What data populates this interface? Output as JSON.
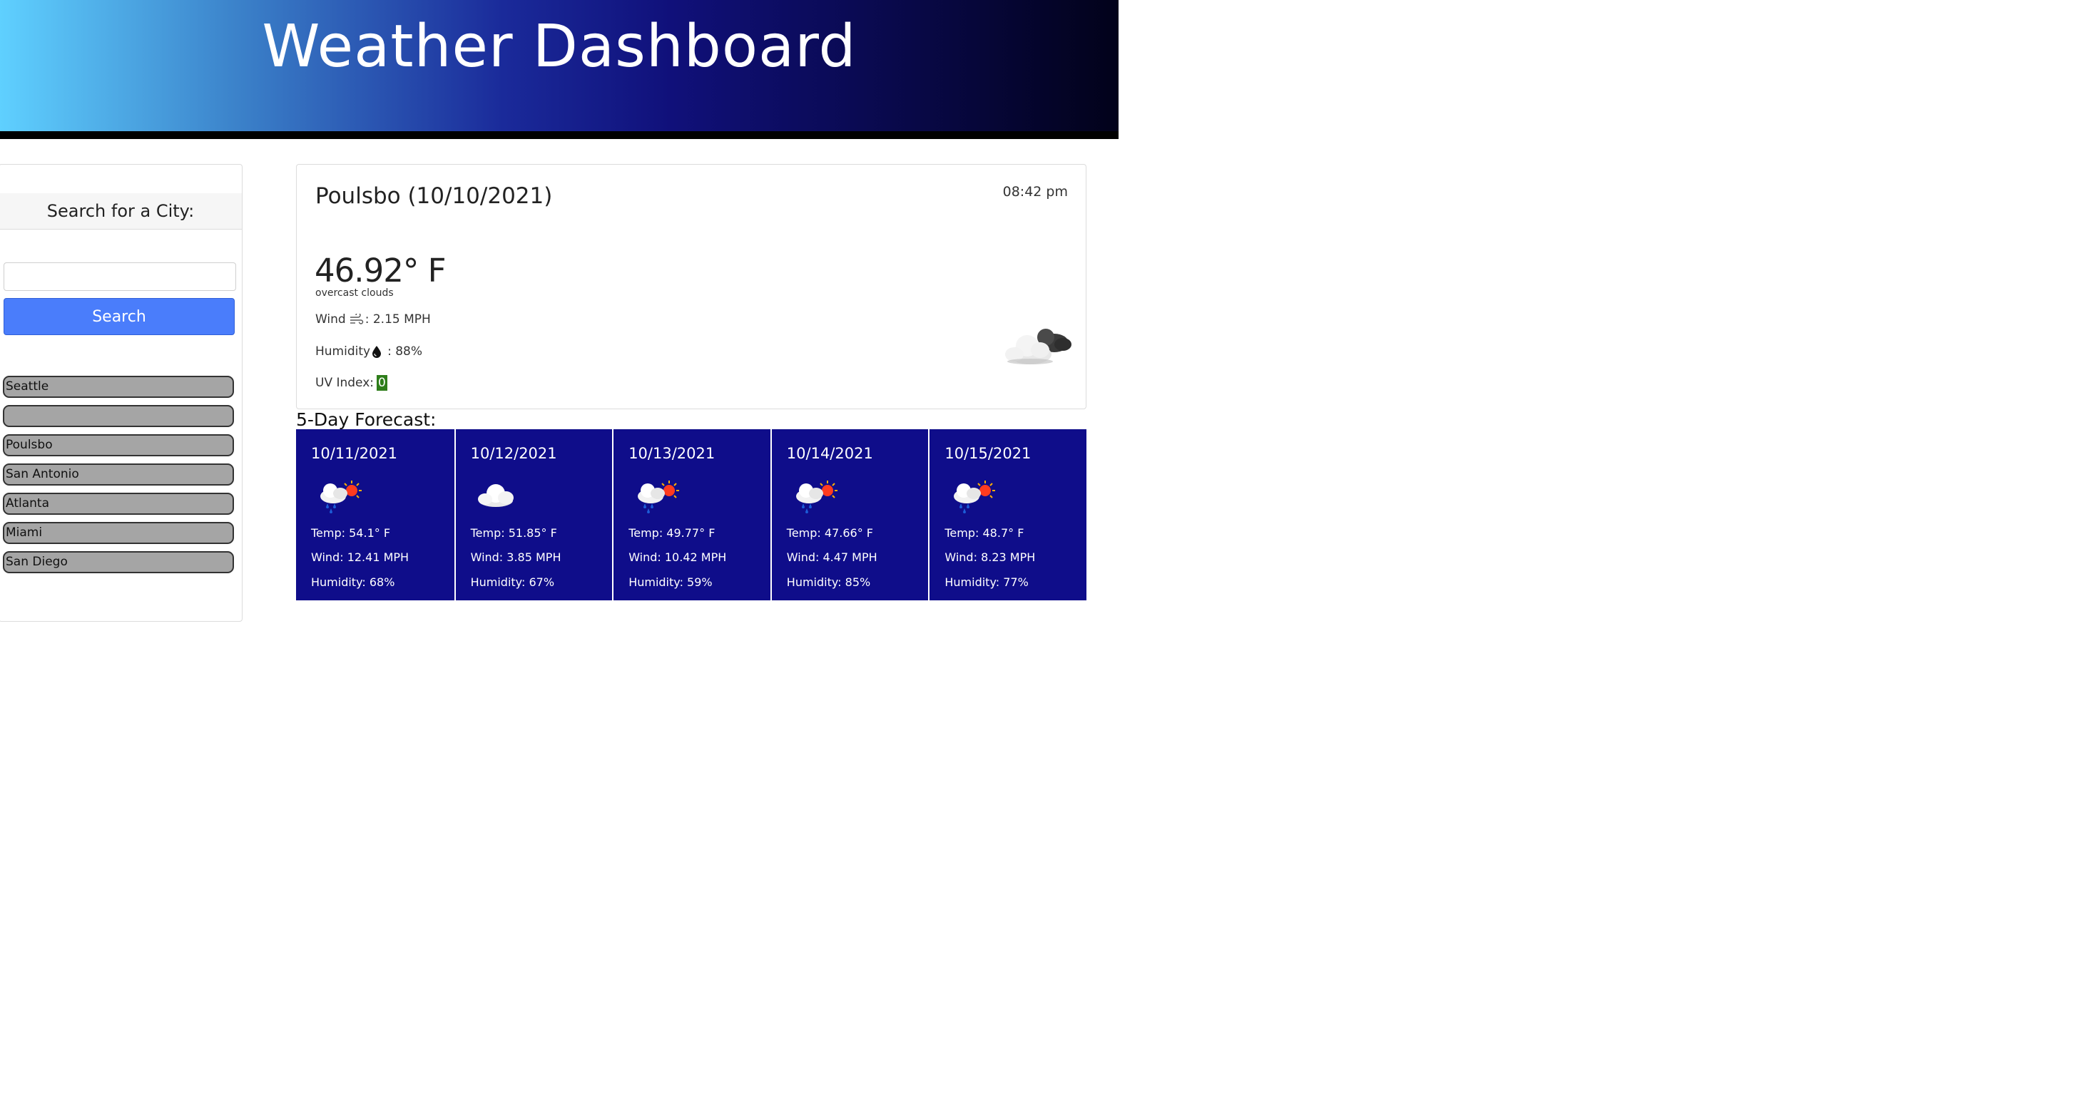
{
  "header": {
    "title": "Weather Dashboard"
  },
  "sidebar": {
    "heading": "Search for a City:",
    "search_input": {
      "value": "",
      "placeholder": ""
    },
    "search_button": "Search",
    "history": [
      "Seattle",
      "",
      "Poulsbo",
      "San Antonio",
      "Atlanta",
      "Miami",
      "San Diego"
    ]
  },
  "current": {
    "city_date": "Poulsbo (10/10/2021)",
    "time": "08:42 pm",
    "temp": "46.92° F",
    "description": "overcast clouds",
    "wind_label": "Wind",
    "wind_value": ": 2.15 MPH",
    "humidity_label": "Humidity",
    "humidity_value": ": 88%",
    "uv_label": "UV Index:",
    "uv_value": "0",
    "uv_color": "#2e7d1a",
    "icon": "overcast-clouds-icon"
  },
  "forecast": {
    "title": "5-Day Forecast:",
    "days": [
      {
        "date": "10/11/2021",
        "icon": "rain-sun-icon",
        "temp": "Temp: 54.1° F",
        "wind": "Wind: 12.41 MPH",
        "humidity": "Humidity: 68%"
      },
      {
        "date": "10/12/2021",
        "icon": "cloud-icon",
        "temp": "Temp: 51.85° F",
        "wind": "Wind: 3.85 MPH",
        "humidity": "Humidity: 67%"
      },
      {
        "date": "10/13/2021",
        "icon": "rain-sun-icon",
        "temp": "Temp: 49.77° F",
        "wind": "Wind: 10.42 MPH",
        "humidity": "Humidity: 59%"
      },
      {
        "date": "10/14/2021",
        "icon": "rain-sun-icon",
        "temp": "Temp: 47.66° F",
        "wind": "Wind: 4.47 MPH",
        "humidity": "Humidity: 85%"
      },
      {
        "date": "10/15/2021",
        "icon": "rain-sun-icon",
        "temp": "Temp: 48.7° F",
        "wind": "Wind: 8.23 MPH",
        "humidity": "Humidity: 77%"
      }
    ]
  },
  "colors": {
    "forecast_bg": "#0f0d8a",
    "search_button": "#4a7dfb",
    "history_bg": "#a5a5a5"
  }
}
